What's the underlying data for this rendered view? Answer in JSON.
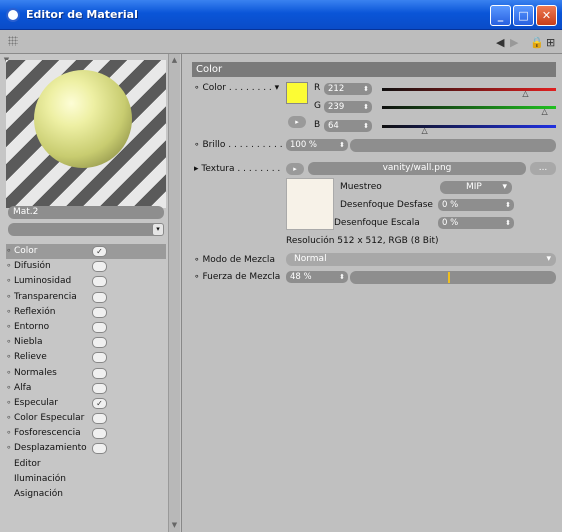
{
  "window": {
    "title": "Editor de Material",
    "minimize": "_",
    "maximize": "□",
    "close": "✕"
  },
  "material": {
    "name": "Mat.2"
  },
  "channels": [
    {
      "label": "Color",
      "checked": true,
      "selected": true
    },
    {
      "label": "Difusión",
      "checked": false
    },
    {
      "label": "Luminosidad",
      "checked": false
    },
    {
      "label": "Transparencia",
      "checked": false
    },
    {
      "label": "Reflexión",
      "checked": false
    },
    {
      "label": "Entorno",
      "checked": false
    },
    {
      "label": "Niebla",
      "checked": false
    },
    {
      "label": "Relieve",
      "checked": false
    },
    {
      "label": "Normales",
      "checked": false
    },
    {
      "label": "Alfa",
      "checked": false
    },
    {
      "label": "Especular",
      "checked": true
    },
    {
      "label": "Color Especular",
      "checked": false
    },
    {
      "label": "Fosforescencia",
      "checked": false
    },
    {
      "label": "Desplazamiento",
      "checked": false
    },
    {
      "label": "Editor",
      "plain": true
    },
    {
      "label": "Iluminación",
      "plain": true
    },
    {
      "label": "Asignación",
      "plain": true
    }
  ],
  "panel": {
    "header": "Color",
    "color_label": "Color",
    "r_label": "R",
    "r_value": "212",
    "g_label": "G",
    "g_value": "239",
    "b_label": "B",
    "b_value": "64",
    "color_hex": "#fcfc34",
    "r_level": 0.83,
    "g_level": 0.94,
    "b_level": 0.25,
    "brillo_label": "Brillo",
    "brillo_value": "100 %",
    "textura_label": "Textura",
    "texture_file": "vanity/wall.png",
    "texture_more": "...",
    "muestreo_label": "Muestreo",
    "muestreo_value": "MIP",
    "desenfoque_desfase_label": "Desenfoque Desfase",
    "desenfoque_desfase_value": "0 %",
    "desenfoque_escala_label": "Desenfoque Escala",
    "desenfoque_escala_value": "0 %",
    "resolucion": "Resolución 512 x 512, RGB (8 Bit)",
    "modo_mezcla_label": "Modo de Mezcla",
    "modo_mezcla_value": "Normal",
    "fuerza_mezcla_label": "Fuerza de Mezcla",
    "fuerza_mezcla_value": "48 %",
    "fuerza_level": 0.48
  }
}
